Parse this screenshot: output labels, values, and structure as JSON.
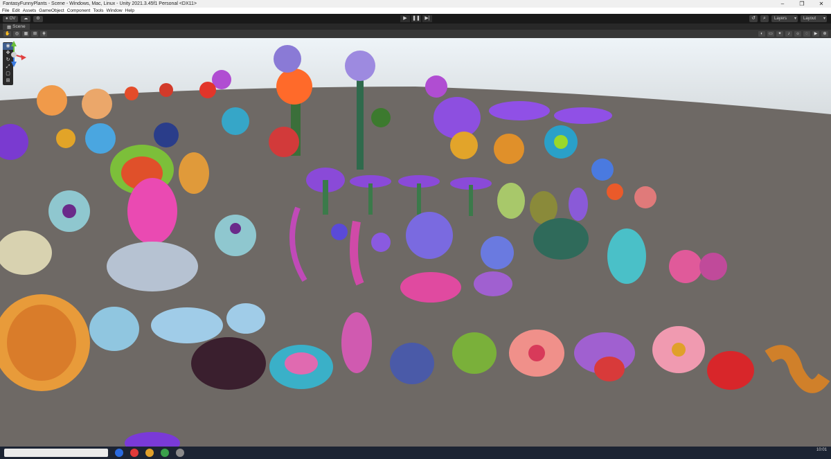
{
  "window": {
    "title": "FantasyFunnyPlants - Scene - Windows, Mac, Linux - Unity 2021.3.45f1 Personal <DX11>",
    "controls": [
      "–",
      "❐",
      "✕"
    ]
  },
  "menu": [
    "File",
    "Edit",
    "Assets",
    "GameObject",
    "Component",
    "Tools",
    "Window",
    "Help"
  ],
  "toolbar": {
    "account": "OV",
    "play": "▶",
    "pause": "❚❚",
    "step": "▶|",
    "layers_label": "Layers",
    "layout_label": "Layout"
  },
  "tab": {
    "label": "Scene"
  },
  "taskbar": {
    "time": "10:01"
  },
  "colors": {
    "editor_bg": "#282828",
    "scene_ground": "#6e6965",
    "sky": "#eef4f8",
    "accent": "#3f5f8f"
  }
}
